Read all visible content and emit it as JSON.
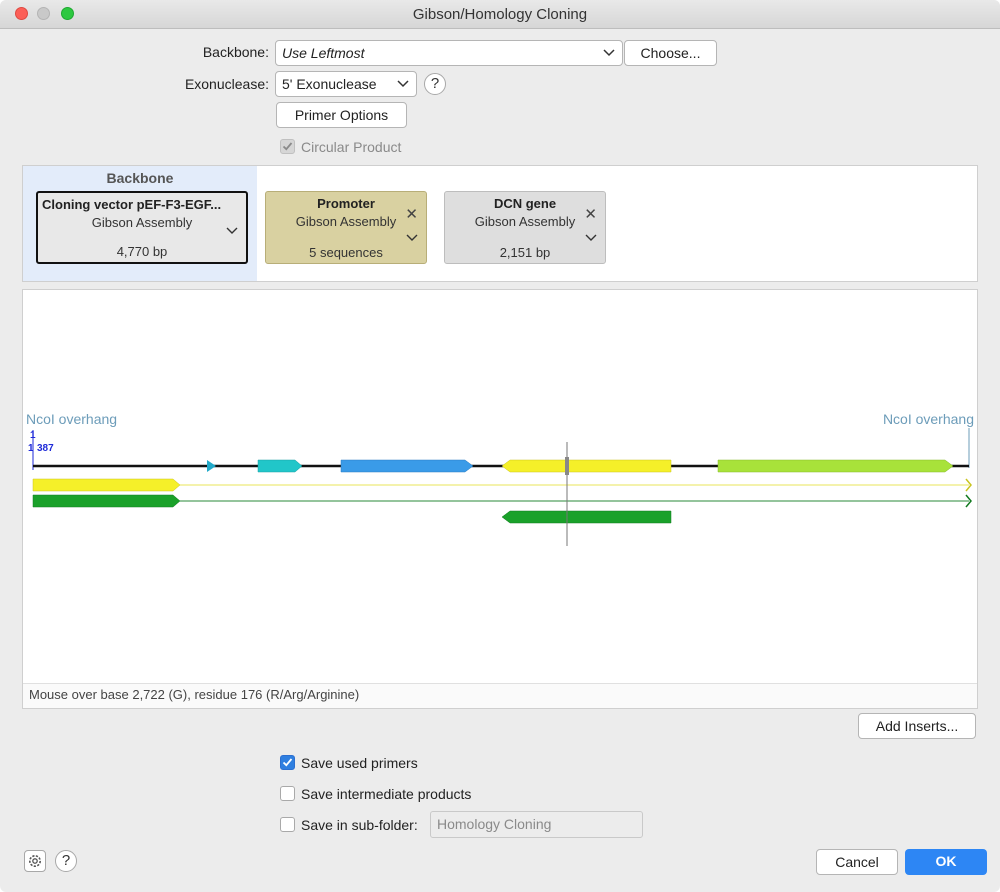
{
  "window": {
    "title": "Gibson/Homology Cloning"
  },
  "form": {
    "backbone_label": "Backbone:",
    "backbone_value": "Use Leftmost",
    "choose_button": "Choose...",
    "exonuclease_label": "Exonuclease:",
    "exonuclease_value": "5' Exonuclease",
    "primer_options_button": "Primer Options",
    "circular_product_label": "Circular Product",
    "circular_product_checked": true
  },
  "parts": {
    "backbone_header": "Backbone",
    "cards": [
      {
        "title": "Cloning vector pEF-F3-EGF...",
        "subtitle": "Gibson Assembly",
        "footer": "4,770 bp",
        "color": "#e8e8e8"
      },
      {
        "title": "Promoter",
        "subtitle": "Gibson Assembly",
        "footer": "5 sequences",
        "color": "#d9d1a1"
      },
      {
        "title": "DCN gene",
        "subtitle": "Gibson Assembly",
        "footer": "2,151 bp",
        "color": "#dedede"
      }
    ]
  },
  "map": {
    "left_label": "NcoI overhang",
    "right_label": "NcoI overhang",
    "pos_start": "1",
    "pos_1": "1",
    "pos_387": "387",
    "status": "Mouse over base 2,722 (G), residue 176 (R/Arg/Arginine)"
  },
  "add_inserts_button": "Add Inserts...",
  "options": {
    "save_primers_label": "Save used primers",
    "save_primers_checked": true,
    "save_intermediate_label": "Save intermediate products",
    "save_intermediate_checked": false,
    "save_subfolder_label": "Save in sub-folder:",
    "save_subfolder_checked": false,
    "subfolder_value": "Homology Cloning"
  },
  "footer": {
    "cancel_button": "Cancel",
    "ok_button": "OK"
  },
  "colors": {
    "accent": "#2d86f4",
    "feature_yellow": "#f5f029",
    "feature_green": "#1aa12a",
    "feature_blue": "#3a9be8",
    "feature_cyan": "#21c6c9",
    "feature_lime": "#a8e23a",
    "label_blue": "#6c9cb9"
  }
}
